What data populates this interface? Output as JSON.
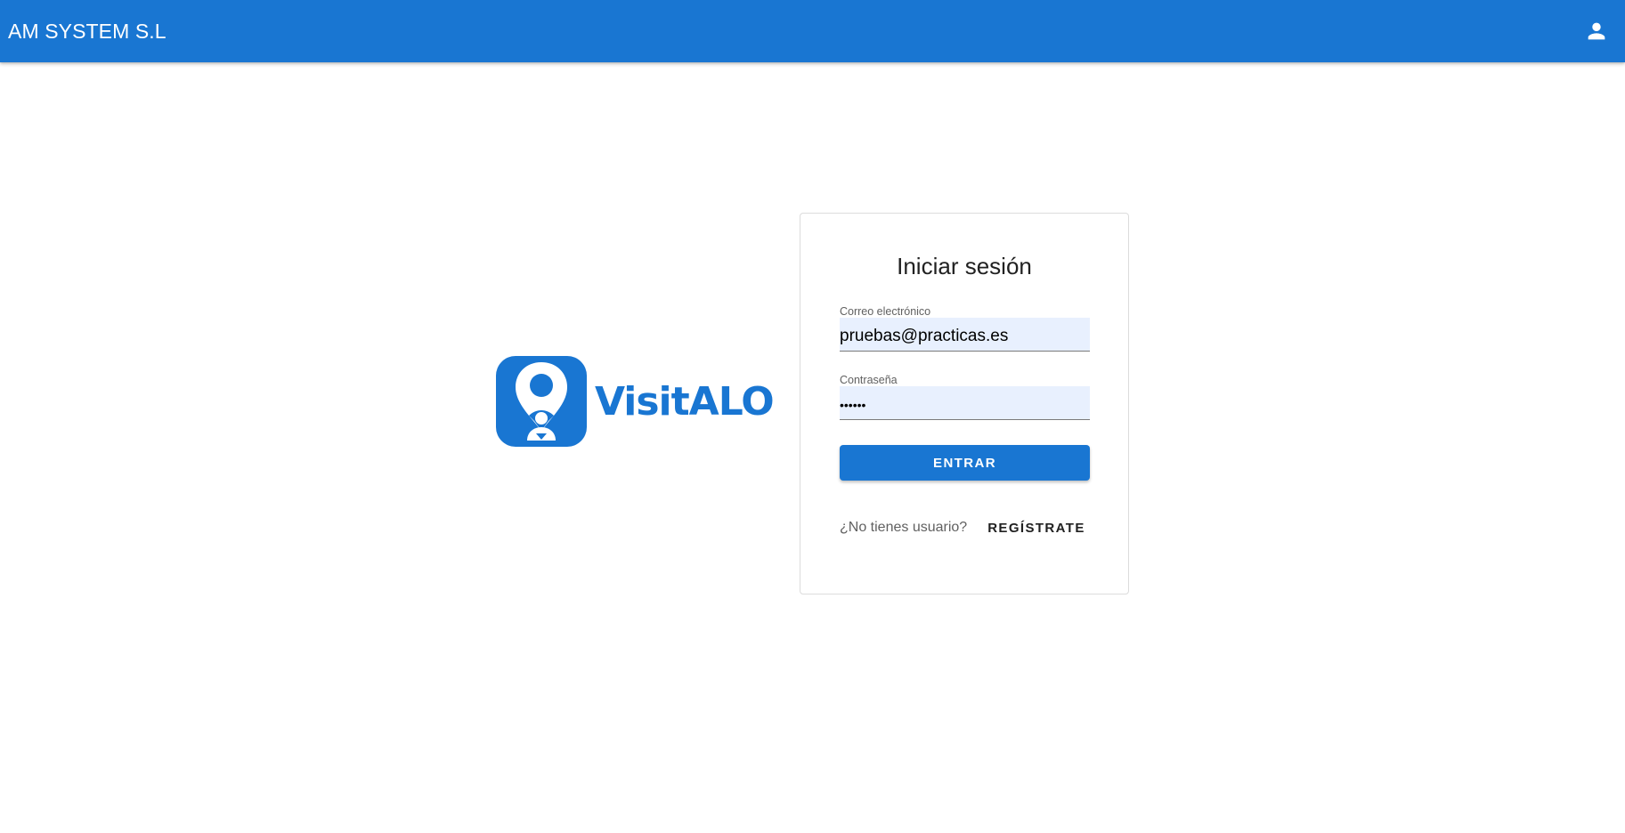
{
  "app_bar": {
    "title": "AM SYSTEM S.L",
    "user_icon": "person-icon",
    "color": "#1976d2"
  },
  "logo": {
    "icon": "location-pin-person-icon",
    "wordmark": "VisitALO",
    "color": "#1976d2"
  },
  "login": {
    "title": "Iniciar sesión",
    "email": {
      "label": "Correo electrónico",
      "value": "pruebas@practicas.es"
    },
    "password": {
      "label": "Contraseña",
      "value": "••••••"
    },
    "submit_label": "ENTRAR",
    "register_prompt": "¿No tienes usuario?",
    "register_label": "REGÍSTRATE"
  },
  "colors": {
    "primary": "#1976d2",
    "autofill_background": "#e8f0fe"
  }
}
